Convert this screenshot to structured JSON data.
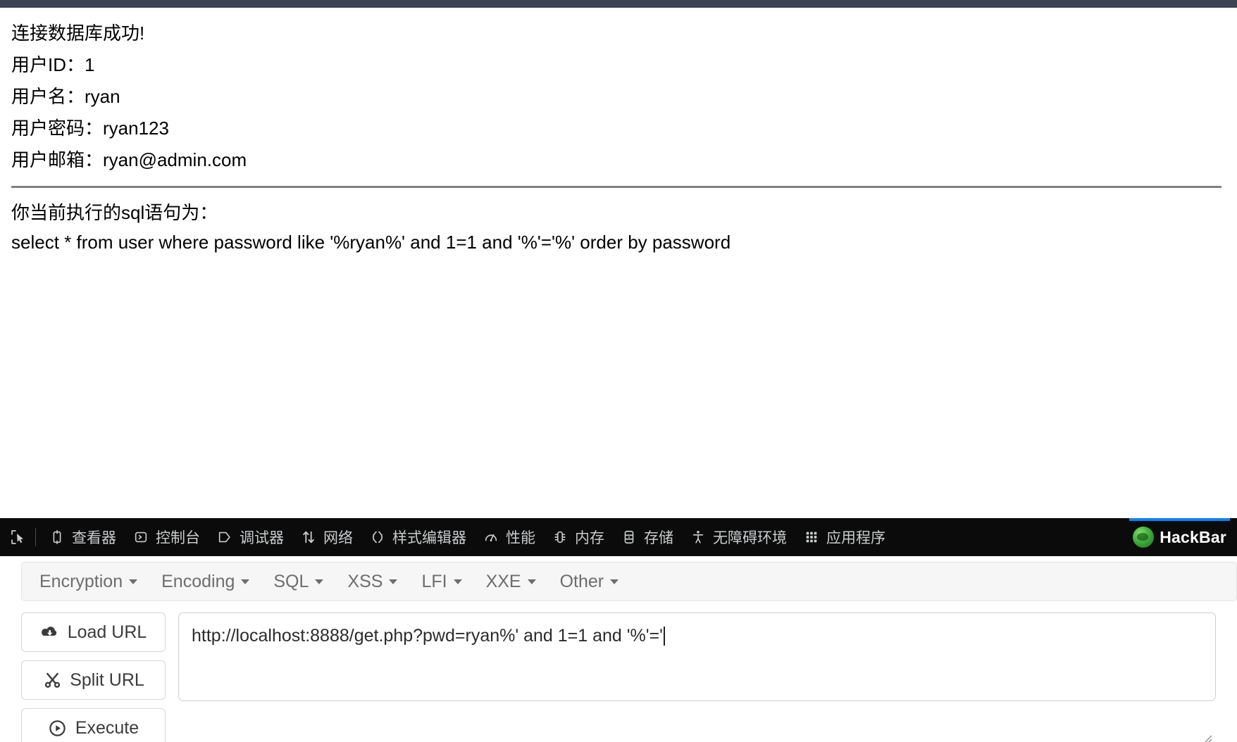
{
  "page": {
    "output_lines": [
      "连接数据库成功!",
      "用户ID：1",
      "用户名：ryan",
      "用户密码：ryan123",
      "用户邮箱：ryan@admin.com"
    ],
    "sql_heading": "你当前执行的sql语句为：",
    "sql_statement": "select * from user where password like '%ryan%' and 1=1 and '%'='%' order by password"
  },
  "devtools": {
    "picker_icon": "element-picker-icon",
    "tabs": [
      {
        "label": "查看器",
        "icon": "inspector-icon",
        "active": false
      },
      {
        "label": "控制台",
        "icon": "console-icon",
        "active": false
      },
      {
        "label": "调试器",
        "icon": "debugger-icon",
        "active": false
      },
      {
        "label": "网络",
        "icon": "network-icon",
        "active": false
      },
      {
        "label": "样式编辑器",
        "icon": "style-editor-icon",
        "active": false
      },
      {
        "label": "性能",
        "icon": "performance-icon",
        "active": false
      },
      {
        "label": "内存",
        "icon": "memory-icon",
        "active": false
      },
      {
        "label": "存储",
        "icon": "storage-icon",
        "active": false
      },
      {
        "label": "无障碍环境",
        "icon": "accessibility-icon",
        "active": false
      },
      {
        "label": "应用程序",
        "icon": "application-icon",
        "active": false
      },
      {
        "label": "HackBar",
        "icon": "hackbar-firefox-icon",
        "active": true
      }
    ],
    "active_tab_accent": "#0a84ff",
    "bar_background": "#0b0b0b"
  },
  "hackbar": {
    "menu": [
      {
        "label": "Encryption"
      },
      {
        "label": "Encoding"
      },
      {
        "label": "SQL"
      },
      {
        "label": "XSS"
      },
      {
        "label": "LFI"
      },
      {
        "label": "XXE"
      },
      {
        "label": "Other"
      }
    ],
    "buttons": [
      {
        "label": "Load URL",
        "icon": "cloud-download-icon"
      },
      {
        "label": "Split URL",
        "icon": "scissors-icon"
      },
      {
        "label": "Execute",
        "icon": "play-circle-icon"
      }
    ],
    "url_field": {
      "value": "http://localhost:8888/get.php?pwd=ryan%' and 1=1 and '%'='",
      "placeholder": "",
      "cursor_visible": true
    }
  },
  "colors": {
    "chrome_strip": "#3c4453",
    "devtools_bg": "#0b0b0b",
    "accent": "#0a84ff",
    "menu_bg": "#f6f6f6",
    "divider": "#808080"
  }
}
